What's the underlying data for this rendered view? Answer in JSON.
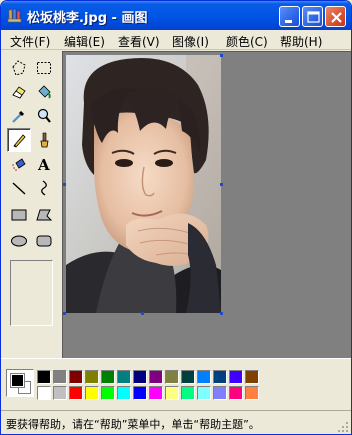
{
  "window": {
    "title": "松坂桃李.jpg - 画图"
  },
  "menu": {
    "items": [
      {
        "label": "文件(F)"
      },
      {
        "label": "编辑(E)"
      },
      {
        "label": "查看(V)"
      },
      {
        "label": "图像(I)"
      },
      {
        "label": "颜色(C)"
      },
      {
        "label": "帮助(H)"
      }
    ]
  },
  "tools": [
    {
      "icon": "free-select-icon"
    },
    {
      "icon": "rect-select-icon"
    },
    {
      "icon": "eraser-icon"
    },
    {
      "icon": "fill-bucket-icon"
    },
    {
      "icon": "color-picker-icon"
    },
    {
      "icon": "magnifier-icon"
    },
    {
      "icon": "pencil-icon",
      "active": true
    },
    {
      "icon": "brush-icon"
    },
    {
      "icon": "airbrush-icon"
    },
    {
      "icon": "text-icon",
      "glyph": "A"
    },
    {
      "icon": "line-icon"
    },
    {
      "icon": "curve-icon"
    },
    {
      "icon": "rectangle-icon"
    },
    {
      "icon": "polygon-icon"
    },
    {
      "icon": "ellipse-icon"
    },
    {
      "icon": "rounded-rect-icon"
    }
  ],
  "palette": {
    "foreground": "#000000",
    "background": "#ffffff",
    "row1": [
      "#000000",
      "#808080",
      "#800000",
      "#808000",
      "#008000",
      "#008080",
      "#000080",
      "#800080",
      "#808040",
      "#004040",
      "#0080ff",
      "#004080",
      "#4000ff",
      "#804000"
    ],
    "row2": [
      "#ffffff",
      "#c0c0c0",
      "#ff0000",
      "#ffff00",
      "#00ff00",
      "#00ffff",
      "#0000ff",
      "#ff00ff",
      "#ffff80",
      "#00ff80",
      "#80ffff",
      "#8080ff",
      "#ff0080",
      "#ff8040"
    ]
  },
  "status": {
    "text": "要获得帮助，请在“帮助”菜单中，单击“帮助主题”。"
  }
}
